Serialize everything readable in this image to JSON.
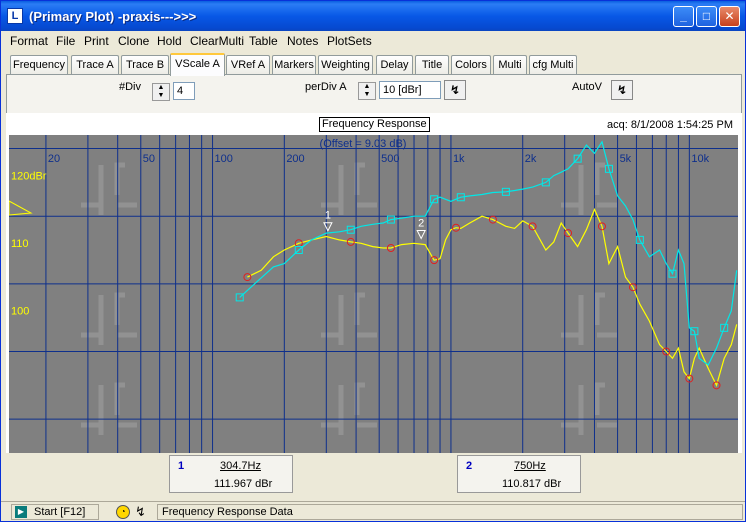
{
  "window": {
    "title": "(Primary Plot) -praxis--->>>",
    "app_icon": "ld-app-icon"
  },
  "menu": [
    "Format",
    "File",
    "Print",
    "Clone",
    "Hold",
    "ClearMulti",
    "Table",
    "Notes",
    "PlotSets"
  ],
  "tabs": [
    {
      "label": "Frequency",
      "active": false
    },
    {
      "label": "Trace A",
      "active": false
    },
    {
      "label": "Trace B",
      "active": false
    },
    {
      "label": "VScale A",
      "active": true
    },
    {
      "label": "VRef A",
      "active": false
    },
    {
      "label": "Markers",
      "active": false
    },
    {
      "label": "Weighting",
      "active": false
    },
    {
      "label": "Delay",
      "active": false
    },
    {
      "label": "Title",
      "active": false
    },
    {
      "label": "Colors",
      "active": false
    },
    {
      "label": "Multi",
      "active": false
    },
    {
      "label": "cfg Multi",
      "active": false
    }
  ],
  "controls": {
    "div_label": "#Div",
    "div_value": "4",
    "perdiv_label": "perDiv A",
    "perdiv_value": "10 [dBr]",
    "autov_label": "AutoV"
  },
  "plot": {
    "title": "Frequency Response",
    "acq": "acq: 8/1/2008 1:54:25 PM",
    "offset": "(Offset = 9.03 dB)",
    "colors": {
      "background": "#808080",
      "grid": "#0e2f8c",
      "trace_a": "#ffff00",
      "trace_b": "#00e8e8",
      "marker_a": "#e02020"
    }
  },
  "chart_data": {
    "type": "line",
    "xscale": "log",
    "xlim": [
      14,
      16000
    ],
    "ylim": [
      80,
      127
    ],
    "x_tick_labels": [
      {
        "x": 20,
        "label": "20"
      },
      {
        "x": 50,
        "label": "50"
      },
      {
        "x": 100,
        "label": "100"
      },
      {
        "x": 200,
        "label": "200"
      },
      {
        "x": 500,
        "label": "500"
      },
      {
        "x": 1000,
        "label": "1k"
      },
      {
        "x": 2000,
        "label": "2k"
      },
      {
        "x": 5000,
        "label": "5k"
      },
      {
        "x": 10000,
        "label": "10k"
      }
    ],
    "y_tick_labels": [
      {
        "y": 120,
        "label": "120dBr"
      },
      {
        "y": 110,
        "label": "110"
      },
      {
        "y": 100,
        "label": "100"
      }
    ],
    "series": [
      {
        "color": "#ffff00",
        "x": [
          140,
          160,
          180,
          200,
          230,
          260,
          300,
          340,
          380,
          420,
          470,
          520,
          560,
          620,
          700,
          780,
          850,
          900,
          950,
          1000,
          1050,
          1100,
          1200,
          1350,
          1500,
          1700,
          1850,
          2000,
          2200,
          2500,
          2700,
          2900,
          3100,
          3400,
          3700,
          4000,
          4300,
          4600,
          5000,
          5400,
          5800,
          6200,
          6800,
          7500,
          8000,
          8500,
          9000,
          9500,
          10000,
          10500,
          11000,
          12000,
          13000,
          14000,
          15000,
          15800
        ],
        "y": [
          106,
          107,
          109,
          110,
          111,
          111.5,
          112,
          111.5,
          111.2,
          111,
          110.5,
          110.3,
          110.3,
          110.8,
          111,
          110.8,
          108.5,
          108.7,
          111.5,
          113,
          113.3,
          113.2,
          114,
          115,
          114.5,
          113.5,
          113.2,
          114.3,
          113.5,
          110,
          111.2,
          114,
          112.5,
          110.5,
          113,
          116,
          113.5,
          108,
          110.5,
          106,
          104.5,
          102,
          99.5,
          96,
          95,
          94,
          95.5,
          92,
          91,
          94,
          95.5,
          92.5,
          90,
          94,
          96,
          99
        ]
      },
      {
        "color": "#00e8e8",
        "x": [
          130,
          150,
          180,
          200,
          230,
          260,
          300,
          340,
          380,
          420,
          470,
          520,
          560,
          620,
          700,
          780,
          850,
          900,
          950,
          1000,
          1100,
          1200,
          1350,
          1500,
          1700,
          1850,
          2000,
          2200,
          2500,
          2700,
          2900,
          3100,
          3400,
          3700,
          4000,
          4300,
          4600,
          5000,
          5400,
          5800,
          6200,
          6800,
          7500,
          8000,
          8500,
          9000,
          9500,
          10000,
          10500,
          11000,
          12000,
          13000,
          14000,
          15000,
          15800
        ],
        "y": [
          103,
          105,
          107.5,
          108,
          110,
          111.5,
          112.5,
          112.7,
          113,
          113.5,
          113.8,
          114,
          114.5,
          114.7,
          115,
          115,
          117.5,
          117.8,
          117.5,
          117.2,
          117.8,
          118,
          118.2,
          118.5,
          118.6,
          118.8,
          119,
          119.3,
          120,
          121,
          121.5,
          122,
          123.5,
          125.5,
          124.3,
          126,
          122,
          118,
          116.5,
          114.5,
          111.5,
          109,
          110,
          108,
          106.5,
          110,
          108,
          98.5,
          98,
          94,
          93,
          95.5,
          98.5,
          101,
          107
        ]
      }
    ],
    "markers": [
      {
        "label": "1",
        "x": 304.7,
        "y": 111.967
      },
      {
        "label": "2",
        "x": 750,
        "y": 110.817
      }
    ]
  },
  "readouts": [
    {
      "num": "1",
      "freq": "304.7Hz",
      "value": "111.967 dBr"
    },
    {
      "num": "2",
      "freq": "750Hz",
      "value": "110.817 dBr"
    }
  ],
  "status": {
    "start": "Start [F12]",
    "message": "Frequency Response Data"
  }
}
